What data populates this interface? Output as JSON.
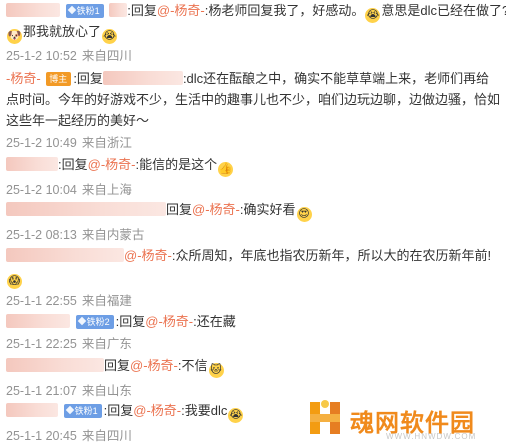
{
  "comments": [
    {
      "badge": "铁粉1",
      "reply": ":回复",
      "mention": "@-杨奇-",
      "text": ":杨老师回复我了，好感动。",
      "emoji1": "😭",
      "text2": "意思是dlc已经在做了?",
      "emoji2": "🐶",
      "text3": "那我就放心了",
      "emoji3": "😭",
      "time": "25-1-2 10:52",
      "loc": "来自四川"
    },
    {
      "author": "-杨奇-",
      "badge": "博主",
      "reply": ":回复",
      "text": ":dlc还在酝酿之中，确实不能草草端上来，老师们再给点时间。今年的好游戏不少，生活中的趣事儿也不少，咱们边玩边聊，边做边骚，恰如这些年一起经历的美好～",
      "time": "25-1-2 10:49",
      "loc": "来自浙江"
    },
    {
      "reply": ":回复",
      "mention": "@-杨奇-",
      "text": ":能信的是这个",
      "emoji1": "👍",
      "time": "25-1-2 10:04",
      "loc": "来自上海"
    },
    {
      "reply": "回复",
      "mention": "@-杨奇-",
      "text": ":确实好看",
      "emoji1": "😍",
      "time": "25-1-2 08:13",
      "loc": "来自内蒙古"
    },
    {
      "mention": "@-杨奇-",
      "text": ":众所周知，年底也指农历新年，所以大的在农历新年前!",
      "emoji1": "😱",
      "time": "25-1-1 22:55",
      "loc": "来自福建"
    },
    {
      "badge": "铁粉2",
      "reply": ":回复",
      "mention": "@-杨奇-",
      "text": ":还在藏",
      "time": "25-1-1 22:25",
      "loc": "来自广东"
    },
    {
      "reply": "回复",
      "mention": "@-杨奇-",
      "text": ":不信",
      "emoji1": "🐱",
      "time": "25-1-1 21:07",
      "loc": "来自山东"
    },
    {
      "badge": "铁粉1",
      "reply": ":回复",
      "mention": "@-杨奇-",
      "text": ":我要dlc",
      "emoji1": "😭",
      "time": "25-1-1 20:45",
      "loc": "来自四川"
    }
  ],
  "watermark": {
    "title": "魂网软件园",
    "url": "WWW.HNWDW.COM"
  }
}
